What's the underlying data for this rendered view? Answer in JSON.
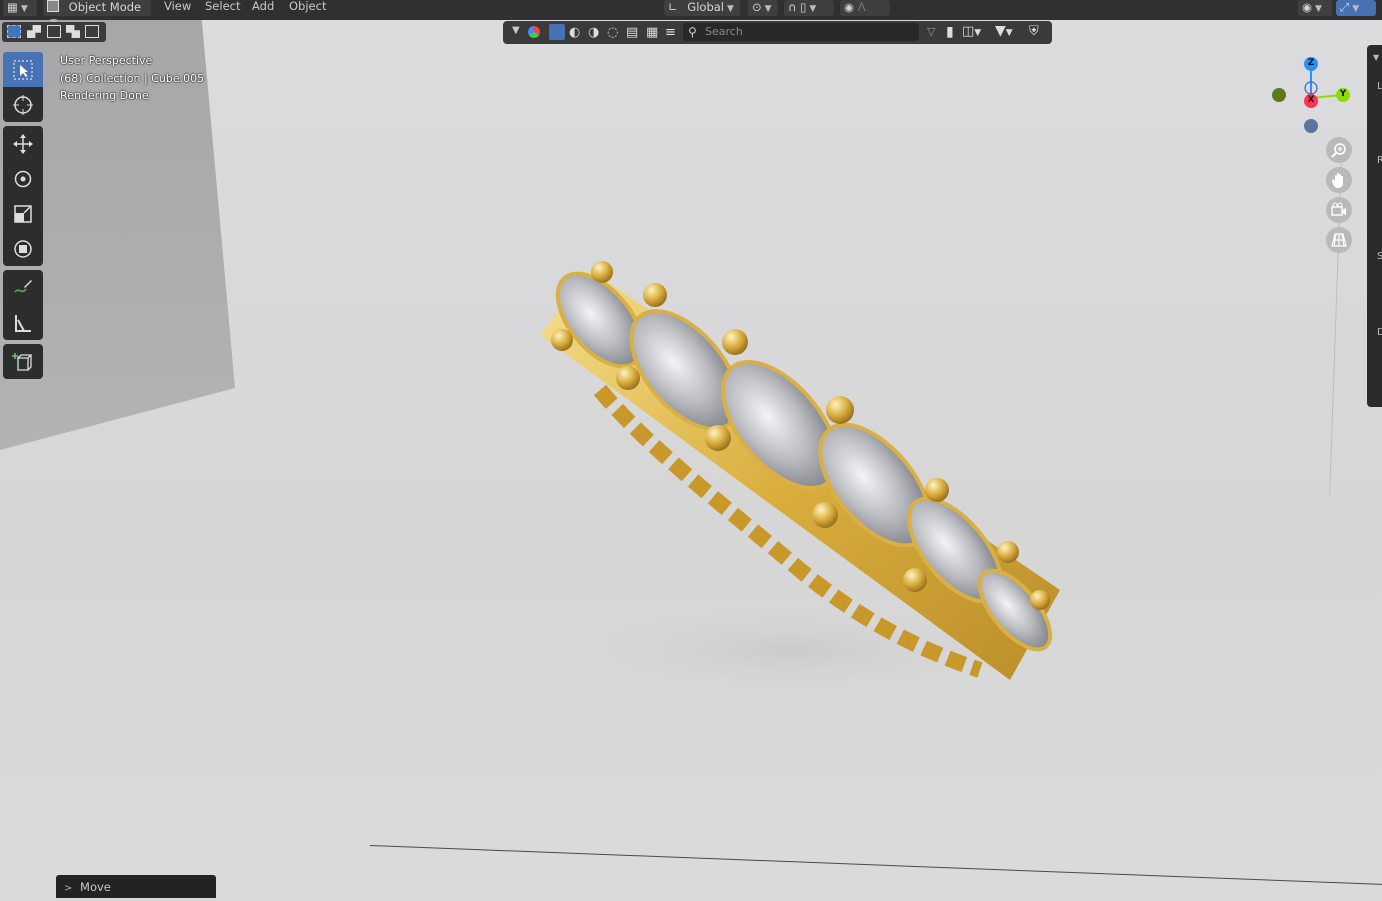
{
  "header": {
    "mode_label": "Object Mode",
    "menus": [
      "View",
      "Select",
      "Add",
      "Object"
    ],
    "transform_orientation": "Global"
  },
  "search": {
    "placeholder": "Search"
  },
  "viewport": {
    "view_name": "User Perspective",
    "collection_info": "(68) Collection | Cube.005",
    "render_status": "Rendering Done"
  },
  "gizmo": {
    "z_label": "Z",
    "y_label": "Y",
    "x_label": "X"
  },
  "right_strip_letters": [
    "L",
    "R",
    "S",
    "D"
  ],
  "operator_panel": {
    "label": "Move"
  },
  "colors": {
    "header_bg": "#303030",
    "active_tool": "#4772b3",
    "axis_x": "#ff3352",
    "axis_y": "#8bdc00",
    "axis_z": "#2890ff",
    "gold": "#d9b03a"
  }
}
